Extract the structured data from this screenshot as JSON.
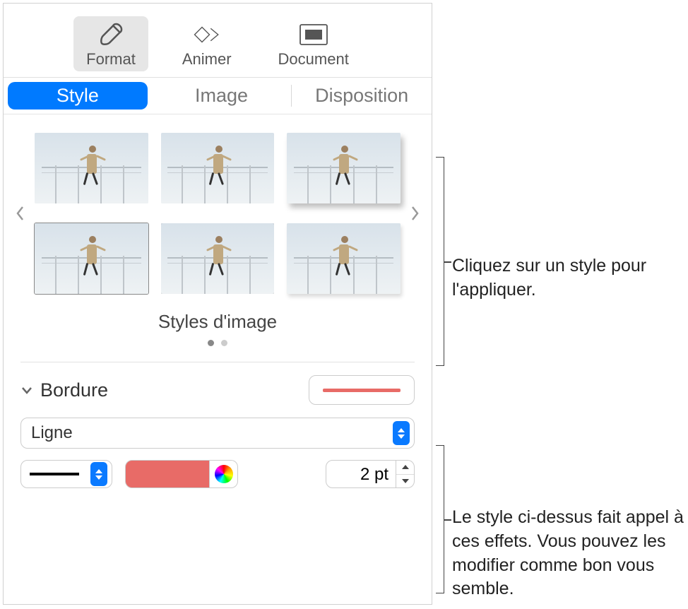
{
  "topbar": {
    "format": "Format",
    "animate": "Animer",
    "document": "Document"
  },
  "tabs": {
    "style": "Style",
    "image": "Image",
    "layout": "Disposition"
  },
  "styles": {
    "title": "Styles d'image"
  },
  "border": {
    "label": "Bordure",
    "type": "Ligne",
    "size": "2 pt",
    "color": "#e86b67"
  },
  "callouts": {
    "c1": "Cliquez sur un style pour l'appliquer.",
    "c2": "Le style ci-dessus fait appel à ces effets. Vous pouvez les modifier comme bon vous semble."
  }
}
